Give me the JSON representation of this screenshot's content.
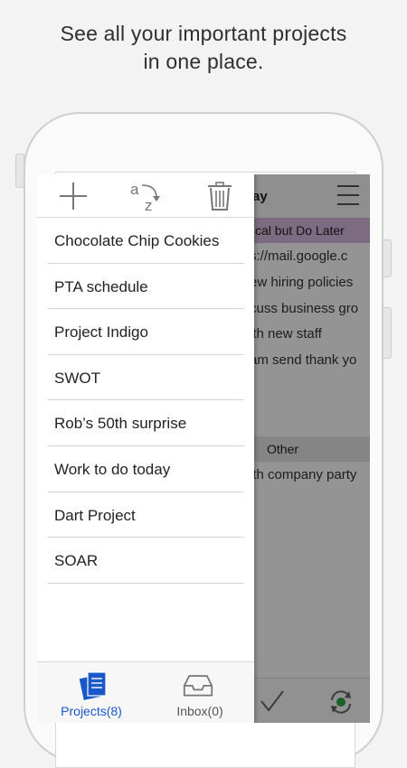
{
  "headline": {
    "line1": "See all your important projects",
    "line2": "in one place."
  },
  "background_app": {
    "title": "ay",
    "category_top": "cal but Do Later",
    "rows": [
      "s://mail.google.c",
      "ew hiring policies",
      "cuss business gro",
      "ith new staff",
      "am send thank yo"
    ],
    "category_other": "Other",
    "rows_other": [
      "ith company party"
    ]
  },
  "drawer": {
    "toolbar": {
      "add_icon": "plus-icon",
      "sort_icon": "sort-az-icon",
      "trash_icon": "trash-icon"
    },
    "projects": [
      "Chocolate Chip Cookies",
      "PTA schedule",
      "Project Indigo",
      "SWOT",
      "Rob’s 50th surprise",
      "Work to do today",
      "Dart Project",
      "SOAR"
    ],
    "tabs": {
      "projects": "Projects(8)",
      "inbox": "Inbox(0)"
    }
  },
  "colors": {
    "accent": "#1a57c9",
    "category_purple": "#d8b8de",
    "sync_green": "#2aa84a"
  }
}
